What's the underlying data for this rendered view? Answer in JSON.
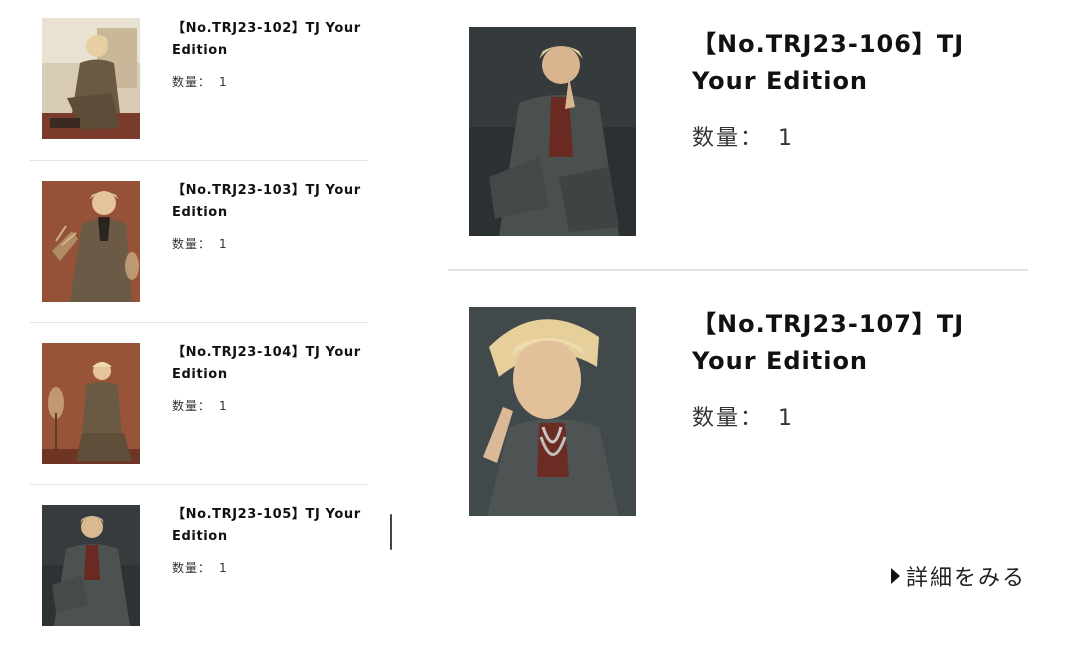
{
  "labels": {
    "qty_label": "数量：",
    "detail_link": "詳細をみる"
  },
  "small_items": [
    {
      "title": "【No.TRJ23-102】TJ Your Edition",
      "qty": "1"
    },
    {
      "title": "【No.TRJ23-103】TJ Your Edition",
      "qty": "1"
    },
    {
      "title": "【No.TRJ23-104】TJ Your Edition",
      "qty": "1"
    },
    {
      "title": "【No.TRJ23-105】TJ Your Edition",
      "qty": "1"
    }
  ],
  "large_items": [
    {
      "title": "【No.TRJ23-106】TJ Your Edition",
      "qty": "1"
    },
    {
      "title": "【No.TRJ23-107】TJ Your Edition",
      "qty": "1"
    }
  ],
  "colors": {
    "divider": "#e3e3e3",
    "text": "#111111",
    "photo_warm_bg": "#8a4a32",
    "photo_dark_bg": "#2f3436",
    "photo_cream_bg": "#d9cdb6"
  },
  "icons": {
    "detail_arrow": "triangle-right-icon"
  }
}
